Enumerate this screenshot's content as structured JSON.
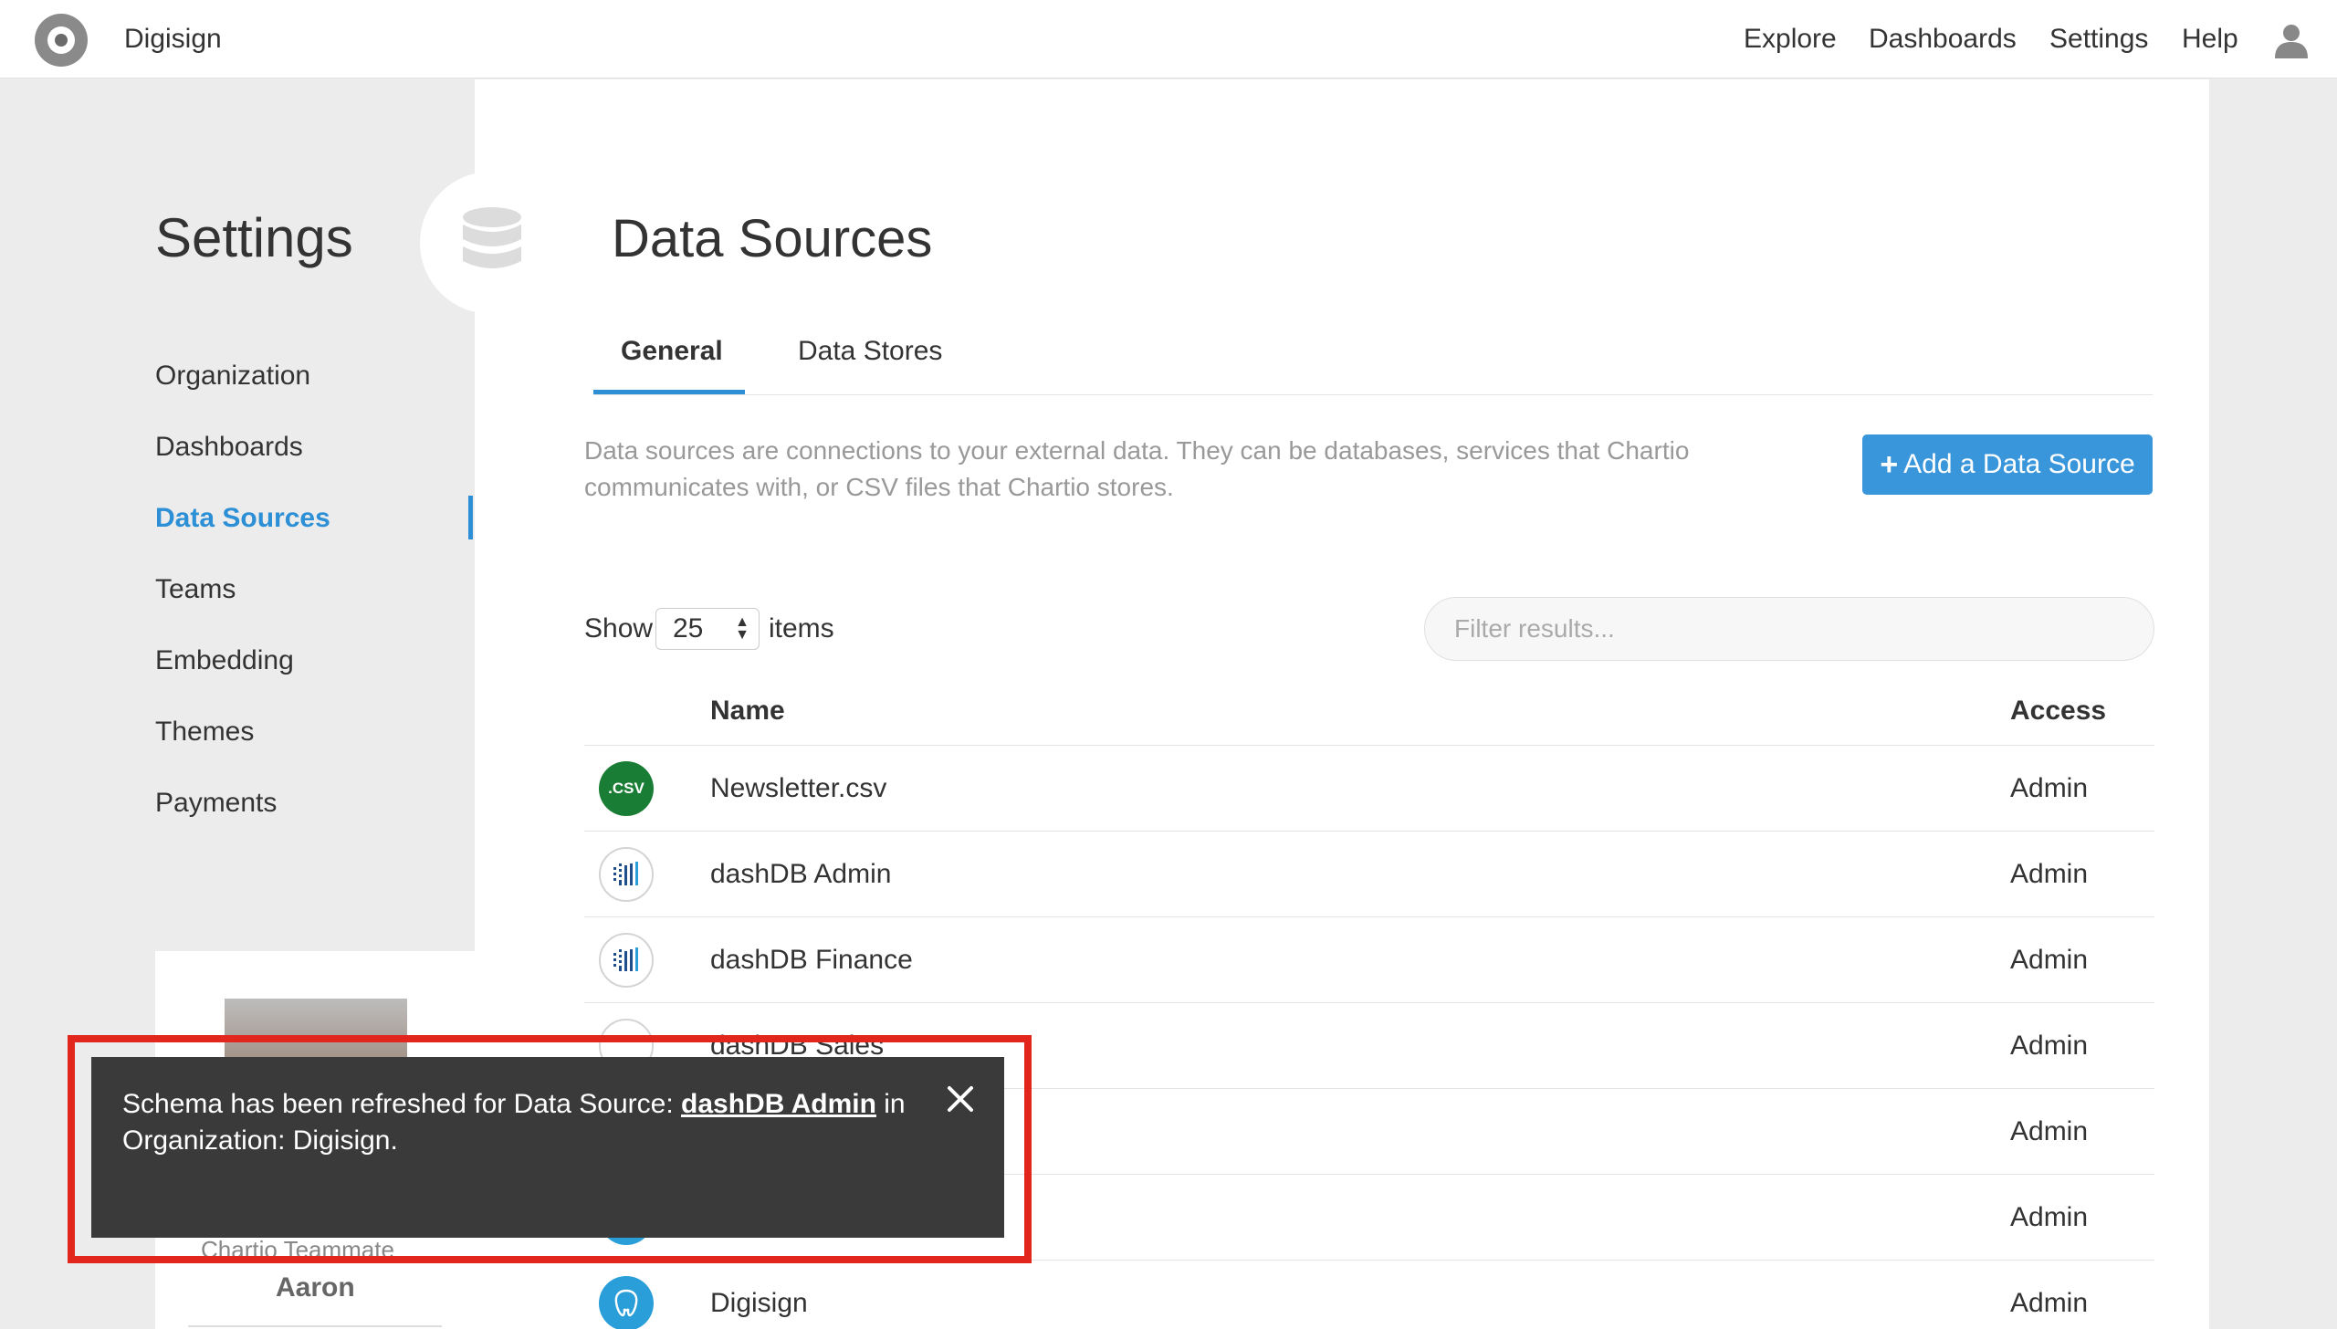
{
  "app": {
    "name": "Digisign"
  },
  "topnav": {
    "items": [
      "Explore",
      "Dashboards",
      "Settings",
      "Help"
    ]
  },
  "sidebar": {
    "title": "Settings",
    "items": [
      {
        "label": "Organization"
      },
      {
        "label": "Dashboards"
      },
      {
        "label": "Data Sources",
        "active": true
      },
      {
        "label": "Teams"
      },
      {
        "label": "Embedding"
      },
      {
        "label": "Themes"
      },
      {
        "label": "Payments"
      }
    ]
  },
  "page": {
    "title": "Data Sources",
    "tabs": [
      {
        "label": "General",
        "active": true
      },
      {
        "label": "Data Stores"
      }
    ],
    "description": "Data sources are connections to your external data. They can be databases, services that Chartio communicates with, or CSV files that Chartio stores.",
    "add_button": {
      "icon": "+",
      "label": "Add a Data Source"
    },
    "show": {
      "prefix": "Show",
      "value": "25",
      "suffix": "items"
    },
    "filter_placeholder": "Filter results...",
    "table": {
      "columns": [
        "Name",
        "Access"
      ],
      "rows": [
        {
          "name": "Newsletter.csv",
          "access": "Admin",
          "icon": "csv-icon",
          "icon_text": ".CSV"
        },
        {
          "name": "dashDB Admin",
          "access": "Admin",
          "icon": "dashdb-icon"
        },
        {
          "name": "dashDB Finance",
          "access": "Admin",
          "icon": "dashdb-icon"
        },
        {
          "name": "dashDB Sales",
          "access": "Admin",
          "icon": "dashdb-icon"
        },
        {
          "name": "",
          "access": "Admin",
          "icon": ""
        },
        {
          "name": "",
          "access": "Admin",
          "icon": "database-icon"
        },
        {
          "name": "Digisign",
          "access": "Admin",
          "icon": "postgres-icon"
        }
      ]
    }
  },
  "user_card": {
    "role": "Chartio Teammate",
    "name": "Aaron"
  },
  "toast": {
    "prefix": "Schema has been refreshed for Data Source: ",
    "link": "dashDB Admin",
    "suffix": " in Organization: Digisign."
  },
  "colors": {
    "accent": "#2d8fd5",
    "button": "#3a96db",
    "toast_bg": "#3a3a3a",
    "highlight": "#e2261d",
    "csv": "#1a7d35"
  }
}
